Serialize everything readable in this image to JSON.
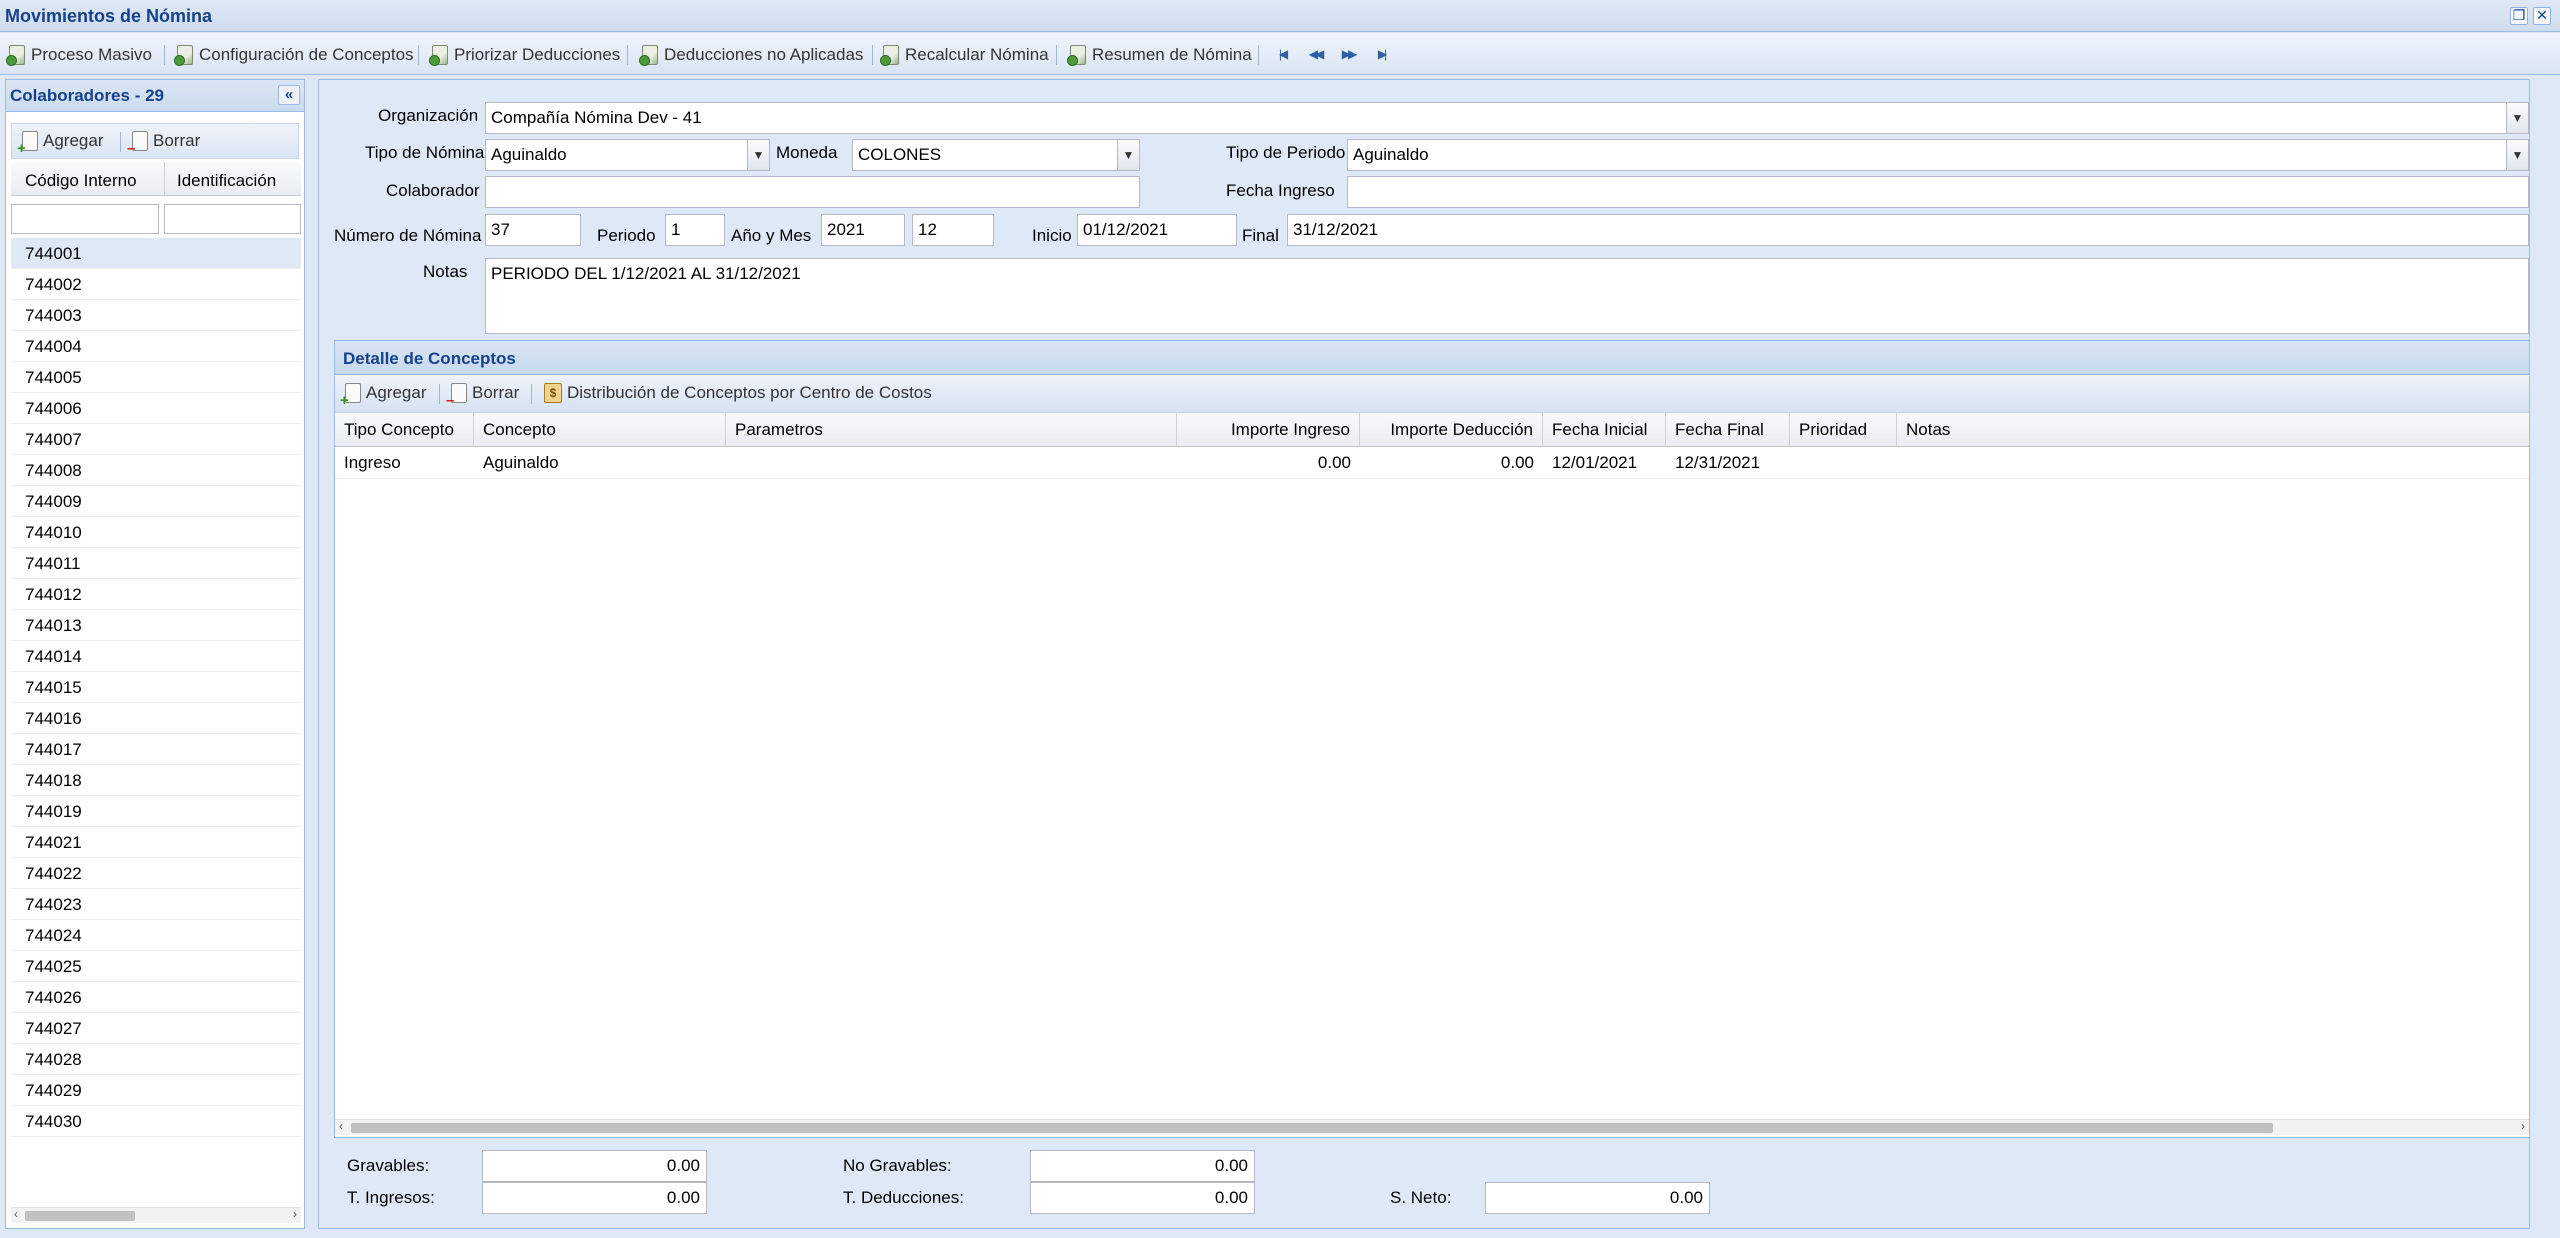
{
  "window": {
    "title": "Movimientos de Nómina"
  },
  "toolbar": {
    "proceso_masivo": "Proceso Masivo",
    "config_conceptos": "Configuración de Conceptos",
    "priorizar_deducciones": "Priorizar Deducciones",
    "deducciones_no_aplicadas": "Deducciones no Aplicadas",
    "recalcular_nomina": "Recalcular Nómina",
    "resumen_nomina": "Resumen de Nómina"
  },
  "left_panel": {
    "title": "Colaboradores - 29",
    "add_label": "Agregar",
    "delete_label": "Borrar",
    "columns": [
      "Código Interno",
      "Identificación"
    ],
    "rows": [
      "744001",
      "744002",
      "744003",
      "744004",
      "744005",
      "744006",
      "744007",
      "744008",
      "744009",
      "744010",
      "744011",
      "744012",
      "744013",
      "744014",
      "744015",
      "744016",
      "744017",
      "744018",
      "744019",
      "744021",
      "744022",
      "744023",
      "744024",
      "744025",
      "744026",
      "744027",
      "744028",
      "744029",
      "744030"
    ]
  },
  "form": {
    "organizacion_label": "Organización",
    "organizacion_value": "Compañía Nómina Dev - 41",
    "tipo_nomina_label": "Tipo de Nómina",
    "tipo_nomina_value": "Aguinaldo",
    "moneda_label": "Moneda",
    "moneda_value": "COLONES",
    "tipo_periodo_label": "Tipo de Periodo",
    "tipo_periodo_value": "Aguinaldo",
    "colaborador_label": "Colaborador",
    "colaborador_value": "",
    "fecha_ingreso_label": "Fecha Ingreso",
    "fecha_ingreso_value": "",
    "numero_nomina_label": "Número de Nómina",
    "numero_nomina_value": "37",
    "periodo_label": "Periodo",
    "periodo_value": "1",
    "anio_mes_label": "Año y Mes",
    "anio_value": "2021",
    "mes_value": "12",
    "inicio_label": "Inicio",
    "inicio_value": "01/12/2021",
    "final_label": "Final",
    "final_value": "31/12/2021",
    "notas_label": "Notas",
    "notas_value": "PERIODO DEL 1/12/2021 AL 31/12/2021"
  },
  "details": {
    "title": "Detalle de Conceptos",
    "add_label": "Agregar",
    "delete_label": "Borrar",
    "distribucion_label": "Distribución de Conceptos por Centro de Costos",
    "columns": {
      "tipo_concepto": "Tipo Concepto",
      "concepto": "Concepto",
      "parametros": "Parametros",
      "importe_ingreso": "Importe Ingreso",
      "importe_deduccion": "Importe Deducción",
      "fecha_inicial": "Fecha Inicial",
      "fecha_final": "Fecha Final",
      "prioridad": "Prioridad",
      "notas": "Notas"
    },
    "rows": [
      {
        "tipo_concepto": "Ingreso",
        "concepto": "Aguinaldo",
        "parametros": "",
        "importe_ingreso": "0.00",
        "importe_deduccion": "0.00",
        "fecha_inicial": "12/01/2021",
        "fecha_final": "12/31/2021",
        "prioridad": "",
        "notas": ""
      }
    ]
  },
  "summary": {
    "gravables_label": "Gravables:",
    "gravables_value": "0.00",
    "no_gravables_label": "No Gravables:",
    "no_gravables_value": "0.00",
    "t_ingresos_label": "T. Ingresos:",
    "t_ingresos_value": "0.00",
    "t_deducciones_label": "T. Deducciones:",
    "t_deducciones_value": "0.00",
    "s_neto_label": "S. Neto:",
    "s_neto_value": "0.00"
  }
}
